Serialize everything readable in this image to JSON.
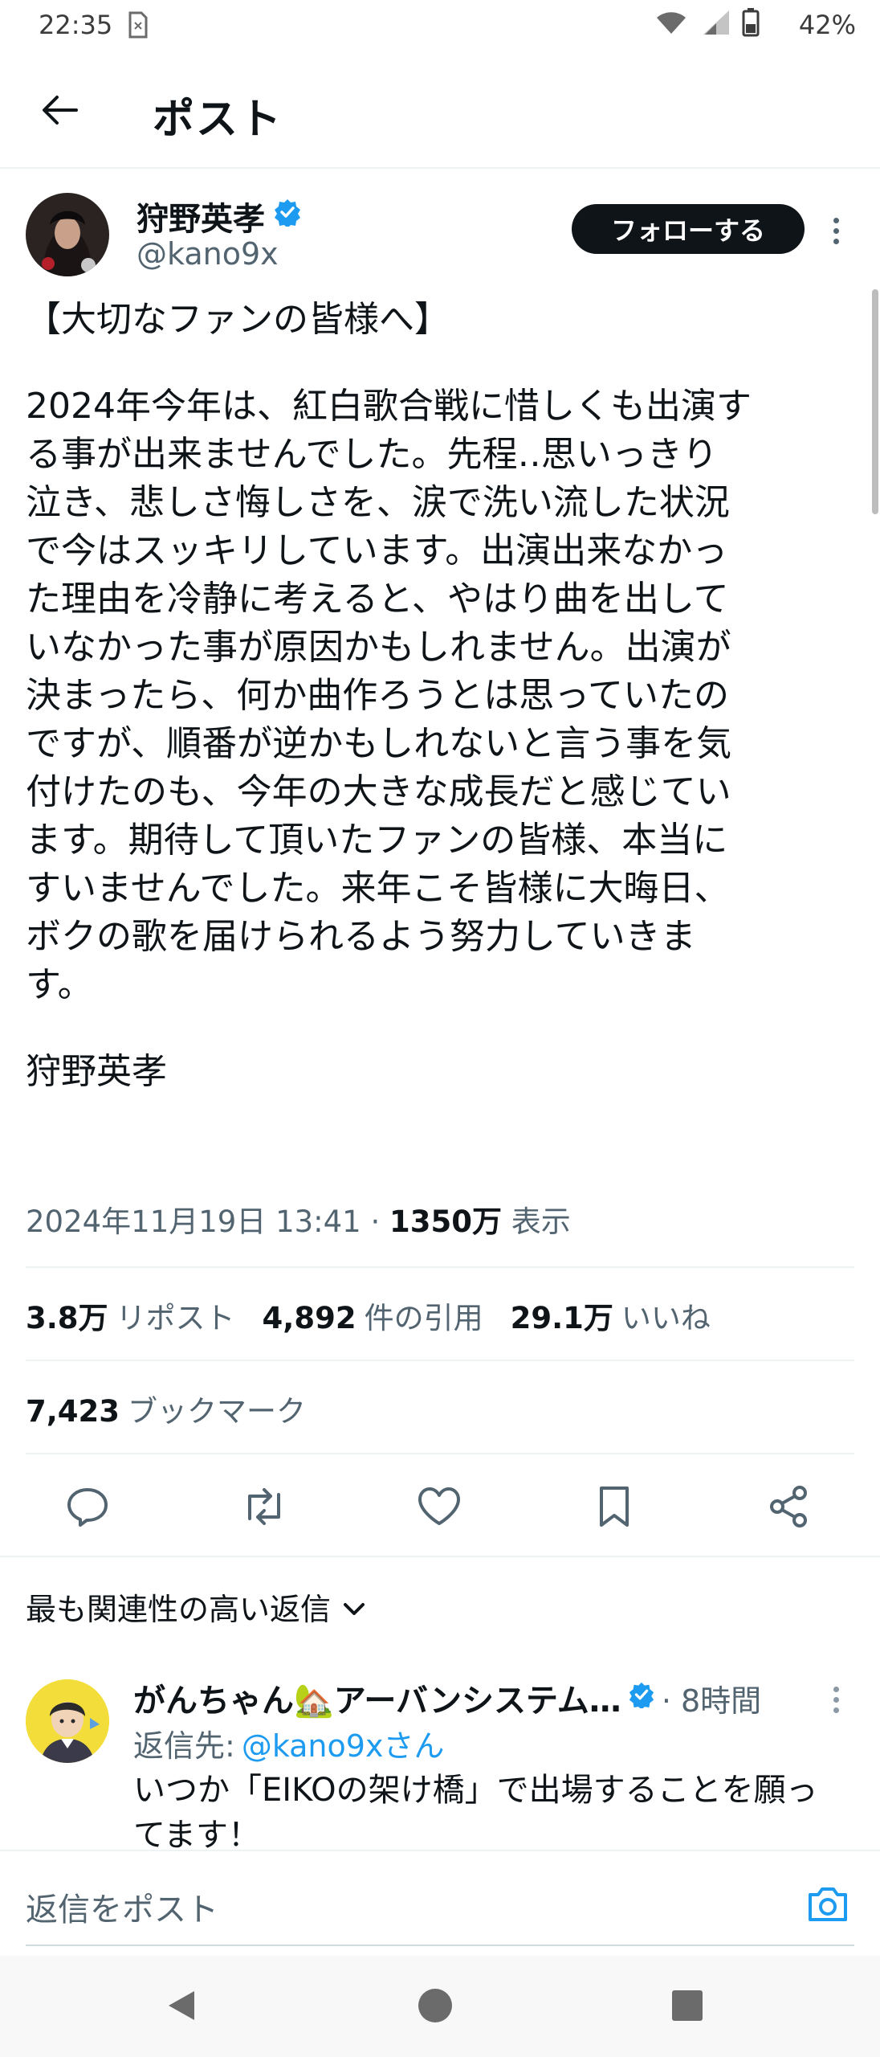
{
  "status_bar": {
    "time": "22:35",
    "battery": "42%"
  },
  "header": {
    "title": "ポスト"
  },
  "author": {
    "name": "狩野英孝",
    "handle": "@kano9x",
    "follow_label": "フォローする"
  },
  "tweet": {
    "heading": "【大切なファンの皆様へ】",
    "lines": [
      "2024年今年は、紅白歌合戦に惜しくも出演す",
      "る事が出来ませんでした。先程‥思いっきり",
      "泣き、悲しさ悔しさを、涙で洗い流した状況",
      "で今はスッキリしています。出演出来なかっ",
      "た理由を冷静に考えると、やはり曲を出して",
      "いなかった事が原因かもしれません。出演が",
      "決まったら、何か曲作ろうとは思っていたの",
      "ですが、順番が逆かもしれないと言う事を気",
      "付けたのも、今年の大きな成長だと感じてい",
      "ます。期待して頂いたファンの皆様、本当に",
      "すいませんでした。来年こそ皆様に大晦日、",
      "ボクの歌を届けられるよう努力していきま",
      "す。"
    ],
    "signature": "狩野英孝"
  },
  "meta": {
    "date": "2024年11月19日 13:41",
    "separator": "·",
    "views": "1350万",
    "views_label": "表示"
  },
  "stats": {
    "reposts": "3.8万",
    "reposts_label": "リポスト",
    "quotes": "4,892",
    "quotes_label": "件の引用",
    "likes": "29.1万",
    "likes_label": "いいね",
    "bookmarks": "7,423",
    "bookmarks_label": "ブックマーク"
  },
  "replies_sort": {
    "label": "最も関連性の高い返信"
  },
  "reply": {
    "name": "がんちゃん🏡アーバンシステム…",
    "time": "· 8時間",
    "reply_to_label": "返信先:",
    "reply_to_handle": "@kano9xさん",
    "text_line1": "いつか「EIKOの架け橋」で出場することを願っ",
    "text_line2": "てます！"
  },
  "compose": {
    "placeholder": "返信をポスト"
  },
  "colors": {
    "accent": "#1d9bf0",
    "text": "#0f1419",
    "muted": "#536471"
  }
}
